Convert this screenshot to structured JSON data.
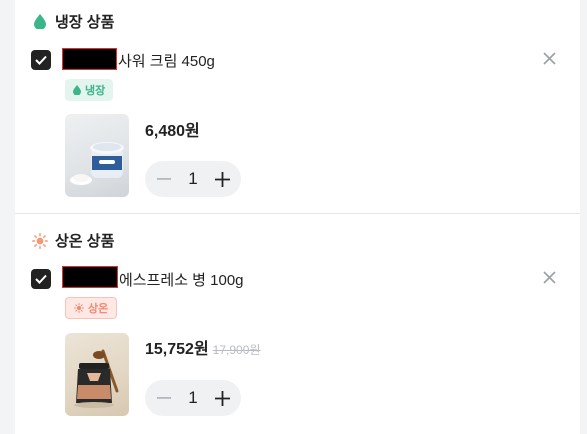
{
  "sections": [
    {
      "title": "냉장 상품",
      "icon": "water-drop-icon",
      "item": {
        "name": "사워 크림 450g",
        "tag": "냉장",
        "price": "6,480원",
        "original_price": "",
        "quantity": "1",
        "image": "sour-cream-tub"
      }
    },
    {
      "title": "상온 상품",
      "icon": "sun-icon",
      "item": {
        "name": "에스프레소 병 100g",
        "tag": "상온",
        "price": "15,752원",
        "original_price": "17,900원",
        "quantity": "1",
        "image": "espresso-jar"
      }
    }
  ],
  "colors": {
    "cold_accent": "#3bb58a",
    "room_accent": "#f08a73",
    "checkbox": "#222222"
  }
}
